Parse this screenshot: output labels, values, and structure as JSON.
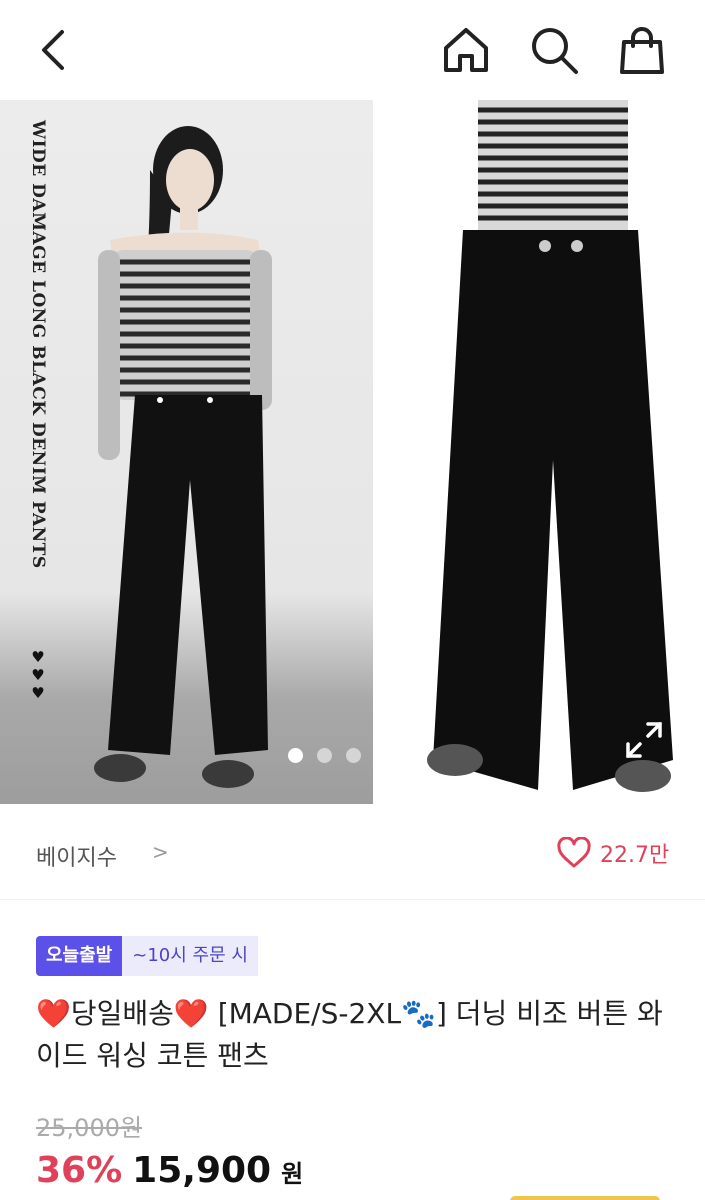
{
  "icons": {
    "back": "chevron-left-icon",
    "home": "home-icon",
    "search": "search-icon",
    "bag": "shopping-bag-icon",
    "like": "heart-outline-icon",
    "expand": "expand-icon"
  },
  "gallery": {
    "overlay_text": "WIDE DAMAGE LONG BLACK DENIM PANTS",
    "hearts": "♥♥♥",
    "current_index": 1,
    "total_dots": 3
  },
  "brand": {
    "name": "베이지수",
    "chevron": ">"
  },
  "like": {
    "count": "22.7만"
  },
  "badges": {
    "today": "오늘출발",
    "order": "~10시 주문 시"
  },
  "product": {
    "title_prefix_heart": "❤️",
    "title_part1": "당일배송",
    "title_suffix_heart": "❤️",
    "title_part2": " [MADE/S-2XL🐾] 더닝 비조 버튼 와이드 워싱 코튼 팬츠",
    "original_price": "25,000원",
    "discount": "36%",
    "price": "15,900",
    "currency": "원"
  },
  "colors": {
    "accent_pink": "#e0415a",
    "badge_purple": "#5b50e8"
  }
}
